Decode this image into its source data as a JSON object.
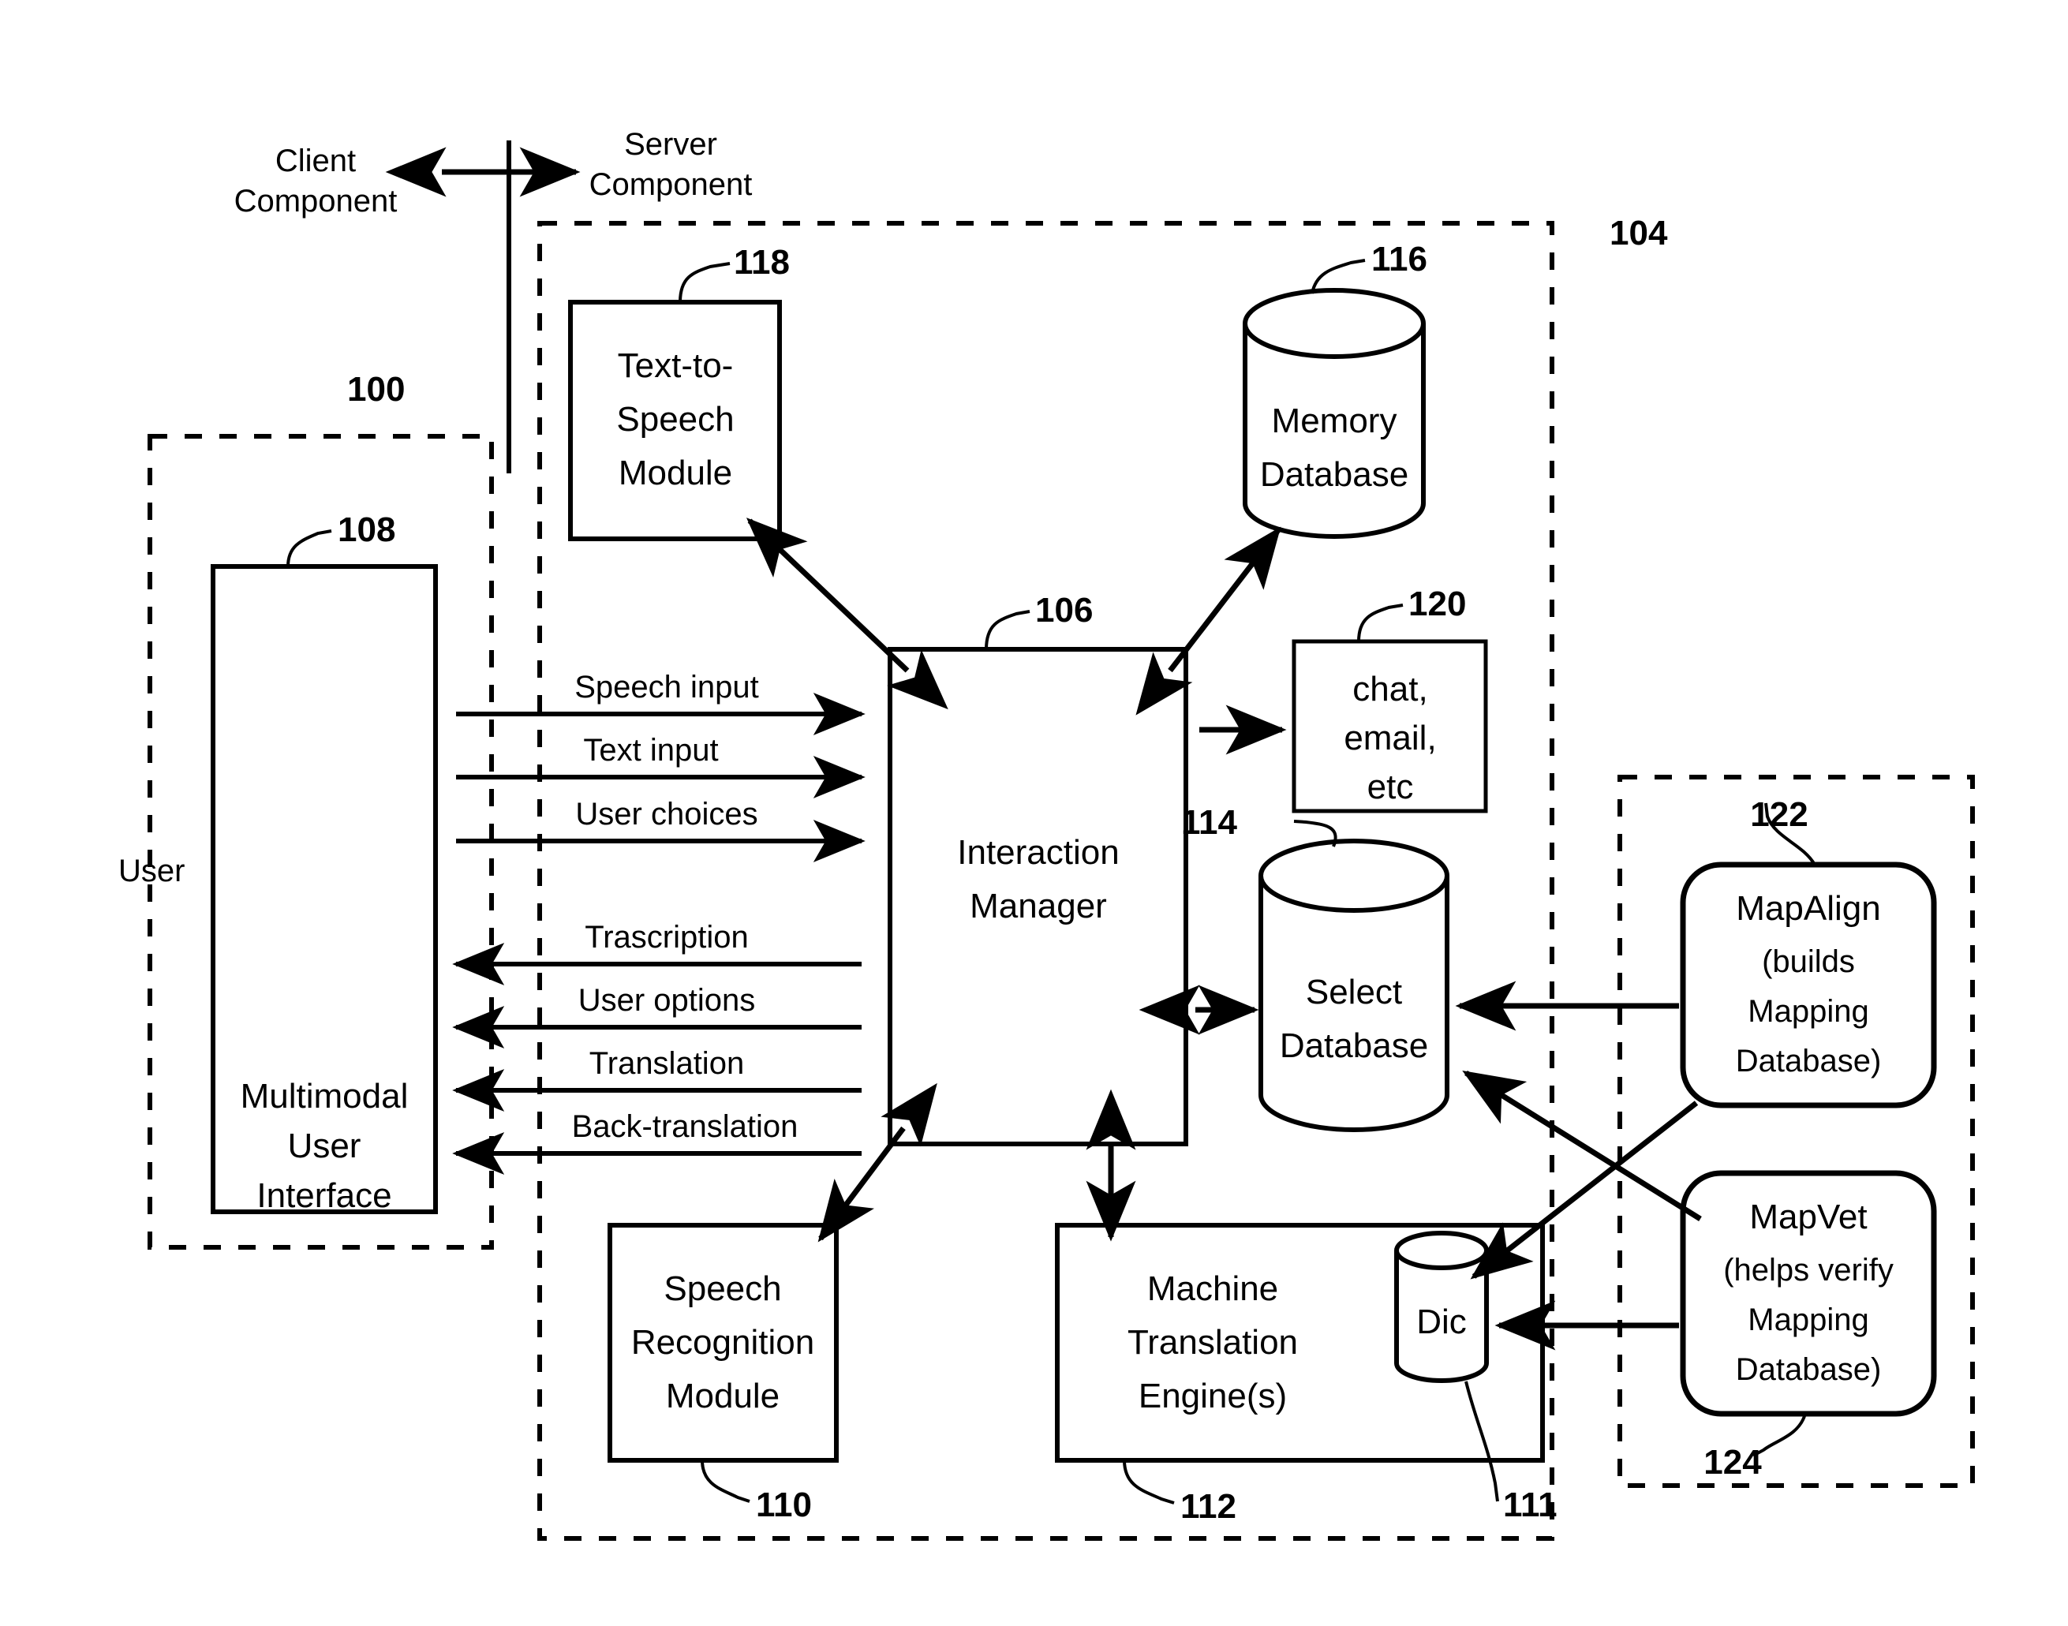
{
  "figure": {
    "title": "Client-Server Multimodal Speech Translation System Block Diagram",
    "boundary_labels": {
      "client": "Client\nComponent",
      "client_line1": "Client",
      "client_line2": "Component",
      "server_line1": "Server",
      "server_line2": "Component",
      "user": "User"
    },
    "reference_numerals": {
      "client_component": "100",
      "server_component": "104",
      "interaction_manager": "106",
      "multimodal_ui": "108",
      "speech_recognition": "110",
      "dictionary": "111",
      "machine_translation": "112",
      "select_database": "114",
      "memory_database": "116",
      "text_to_speech": "118",
      "chat_email_etc": "120",
      "mapalign": "122",
      "mapvet": "124"
    },
    "blocks": {
      "text_to_speech": {
        "lines": [
          "Text-to-",
          "Speech",
          "Module"
        ],
        "ref": "118"
      },
      "memory_database": {
        "lines": [
          "Memory",
          "Database"
        ],
        "ref": "116"
      },
      "interaction_manager": {
        "lines": [
          "Interaction",
          "Manager"
        ],
        "ref": "106"
      },
      "chat_email": {
        "lines": [
          "chat,",
          "email,",
          "etc"
        ],
        "ref": "120"
      },
      "select_database": {
        "lines": [
          "Select",
          "Database"
        ],
        "ref": "114"
      },
      "mapalign": {
        "lines": [
          "MapAlign",
          "(builds",
          "Mapping",
          "Database)"
        ],
        "ref": "122"
      },
      "mapvet": {
        "lines": [
          "MapVet",
          "(helps verify",
          "Mapping",
          "Database)"
        ],
        "ref": "124"
      },
      "multimodal_ui": {
        "lines": [
          "Multimodal",
          "User",
          "Interface"
        ],
        "ref": "108"
      },
      "speech_recognition": {
        "lines": [
          "Speech",
          "Recognition",
          "Module"
        ],
        "ref": "110"
      },
      "machine_translation": {
        "lines": [
          "Machine",
          "Translation",
          "Engine(s)"
        ],
        "ref": "112"
      },
      "dictionary": {
        "lines": [
          "Dic"
        ],
        "ref": "111"
      }
    },
    "flow_labels": {
      "to_server": [
        "Speech input",
        "Text input",
        "User choices"
      ],
      "to_client": [
        "Trascription",
        "User options",
        "Translation",
        "Back-translation"
      ]
    },
    "colors": {
      "ink": "#000000",
      "paper": "#ffffff"
    }
  }
}
